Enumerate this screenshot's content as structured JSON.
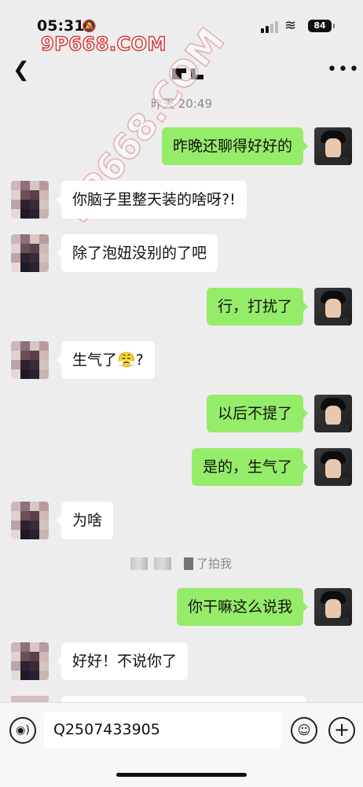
{
  "status_bar": {
    "time": "05:31",
    "battery": "84"
  },
  "watermark": {
    "site": "9P668.COM",
    "diagonal": "9P668.COM"
  },
  "nav": {
    "back_icon": "chevron-left-icon",
    "more_icon": "more-dots-icon"
  },
  "timestamp": "昨天 20:49",
  "messages": [
    {
      "side": "right",
      "text": "昨晚还聊得好好的"
    },
    {
      "side": "left",
      "text": "你脑子里整天装的啥呀?!"
    },
    {
      "side": "left",
      "text": "除了泡妞没别的了吧"
    },
    {
      "side": "right",
      "text": "行，打扰了"
    },
    {
      "side": "left",
      "text": "生气了😤?"
    },
    {
      "side": "right",
      "text": "以后不提了"
    },
    {
      "side": "right",
      "text": "是的，生气了"
    },
    {
      "side": "left",
      "text": "为啥"
    },
    {
      "side": "right",
      "text": "你干嘛这么说我"
    },
    {
      "side": "left",
      "text": "好好！不说你了"
    }
  ],
  "system_notice": {
    "text": "了拍我"
  },
  "input": {
    "value": "Q2507433905"
  },
  "colors": {
    "green_bubble": "#95ec69",
    "background": "#ededed",
    "watermark_red": "#d63a3a"
  }
}
